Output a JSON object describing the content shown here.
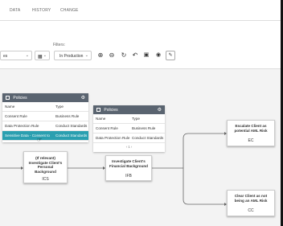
{
  "tabs": [
    {
      "label": "DATA"
    },
    {
      "label": "HISTORY"
    },
    {
      "label": "CHANGE"
    }
  ],
  "toolbar": {
    "filters_label": "Filters:",
    "left_select": "es",
    "grid_select_icon": "grid-icon",
    "status_select": "In Production",
    "icons": [
      "zoom-in-icon",
      "zoom-out-icon",
      "refresh-icon",
      "undo-icon",
      "save-icon",
      "eye-icon",
      "edit-icon"
    ]
  },
  "panel_left": {
    "title": "Policies",
    "headers": {
      "name": "Name",
      "type": "Type"
    },
    "rows": [
      {
        "name": "Consent Rule",
        "type": "Business Rule"
      },
      {
        "name": "Data Protection Rule",
        "type": "Conduct Standards"
      },
      {
        "name": "Sensitive Data - Consent to",
        "type": "Conduct Standards"
      }
    ]
  },
  "panel_right": {
    "title": "Policies",
    "headers": {
      "name": "Name",
      "type": "Type"
    },
    "rows": [
      {
        "name": "Consent Rule",
        "type": "Business Rule"
      },
      {
        "name": "Data Protection Rule",
        "type": "Conduct Standards"
      }
    ],
    "pager": "‹ 1 ›"
  },
  "nodes": {
    "ics": {
      "title": "(If relevant) Investigate Client's Personal Background",
      "code": "ICS"
    },
    "ifb": {
      "title": "Investigate Client's Financial Background",
      "code": "IFB"
    },
    "ec": {
      "title": "Escalate Client as potential AML Risk",
      "code": "EC"
    },
    "cc": {
      "title": "Clear Client as not being an AML Risk",
      "code": "CC"
    }
  },
  "colors": {
    "panel_header": "#5a6470",
    "selected_row": "#2a9fb0"
  }
}
